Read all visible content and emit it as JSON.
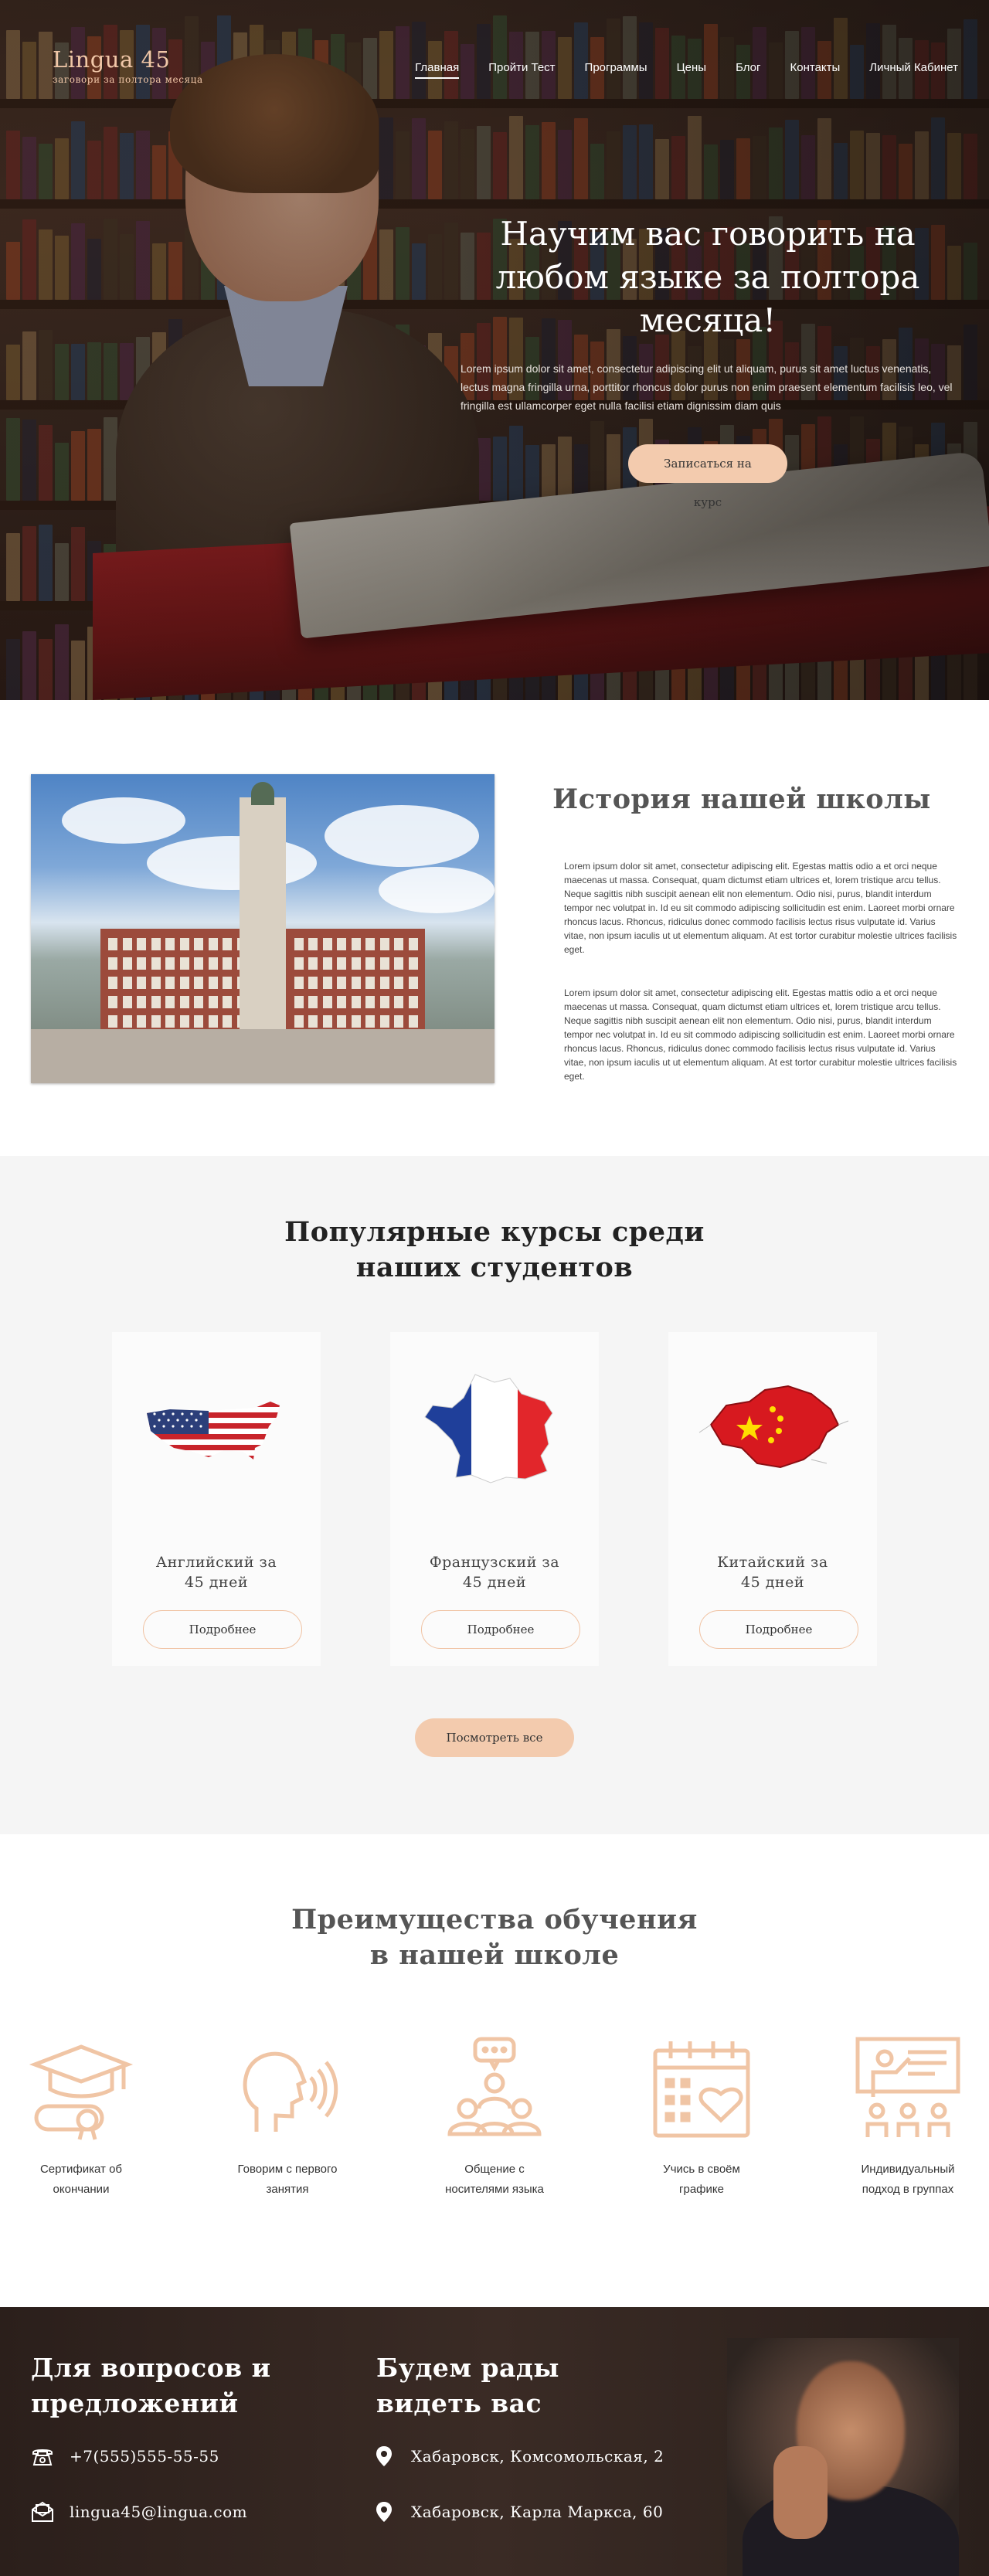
{
  "brand": {
    "name": "Lingua 45",
    "tagline": "заговори за полтора месяца"
  },
  "nav": [
    {
      "label": "Главная",
      "active": true
    },
    {
      "label": "Пройти Тест"
    },
    {
      "label": "Программы"
    },
    {
      "label": "Цены"
    },
    {
      "label": "Блог"
    },
    {
      "label": "Контакты"
    },
    {
      "label": "Личный Кабинет"
    }
  ],
  "hero": {
    "title": "Научим вас говорить на любом языке за полтора месяца!",
    "text": "Lorem ipsum dolor sit amet, consectetur adipiscing elit ut aliquam, purus sit amet luctus venenatis, lectus magna fringilla urna, porttitor rhoncus dolor purus non enim praesent elementum facilisis leo, vel fringilla est ullamcorper eget nulla facilisi etiam dignissim diam quis",
    "button": "Записаться на курс"
  },
  "history": {
    "title": "История нашей школы",
    "paragraphs": [
      "Lorem ipsum dolor sit amet, consectetur adipiscing elit. Egestas mattis odio a et orci neque maecenas ut massa. Consequat, quam dictumst etiam ultrices et, lorem tristique arcu tellus. Neque sagittis nibh suscipit aenean elit non elementum. Odio nisi, purus, blandit interdum tempor nec volutpat in. Id eu sit commodo adipiscing sollicitudin est enim. Laoreet morbi ornare rhoncus lacus. Rhoncus, ridiculus donec commodo facilisis lectus risus vulputate id. Varius vitae, non ipsum iaculis ut ut elementum aliquam. At est tortor curabitur molestie ultrices facilisis eget.",
      "Lorem ipsum dolor sit amet, consectetur adipiscing elit. Egestas mattis odio a et orci neque maecenas ut massa. Consequat, quam dictumst etiam ultrices et, lorem tristique arcu tellus. Neque sagittis nibh suscipit aenean elit non elementum. Odio nisi, purus, blandit interdum tempor nec volutpat in. Id eu sit commodo adipiscing sollicitudin est enim. Laoreet morbi ornare rhoncus lacus. Rhoncus, ridiculus donec commodo facilisis lectus risus vulputate id. Varius vitae, non ipsum iaculis ut ut elementum aliquam. At est tortor curabitur molestie ultrices facilisis eget."
    ]
  },
  "courses": {
    "title_line1": "Популярные курсы среди",
    "title_line2": "наших студентов",
    "items": [
      {
        "name_line1": "Английский за",
        "name_line2": "45 дней",
        "button": "Подробнее",
        "icon": "usa-map-flag-icon"
      },
      {
        "name_line1": "Французский за",
        "name_line2": "45 дней",
        "button": "Подробнее",
        "icon": "france-map-flag-icon"
      },
      {
        "name_line1": "Китайский за",
        "name_line2": "45 дней",
        "button": "Подробнее",
        "icon": "china-map-flag-icon"
      }
    ],
    "see_all": "Посмотреть все"
  },
  "advantages": {
    "title_line1": "Преимущества обучения",
    "title_line2": "в нашей школе",
    "items": [
      {
        "line1": "Сертификат об",
        "line2": "окончании",
        "icon": "graduation-diploma-icon"
      },
      {
        "line1": "Говорим с первого",
        "line2": "занятия",
        "icon": "speaking-head-icon"
      },
      {
        "line1": "Общение с",
        "line2": "носителями языка",
        "icon": "group-chat-icon"
      },
      {
        "line1": "Учись в своём",
        "line2": "графике",
        "icon": "calendar-heart-icon"
      },
      {
        "line1": "Индивидуальный",
        "line2": "подход в группах",
        "icon": "presentation-group-icon"
      }
    ]
  },
  "footer": {
    "contacts_title_line1": "Для вопросов и",
    "contacts_title_line2": "предложений",
    "phone": "+7(555)555-55-55",
    "email": "lingua45@lingua.com",
    "address_title_line1": "Будем рады",
    "address_title_line2": "видеть вас",
    "address1": "Хабаровск, Комсомольская, 2",
    "address2": "Хабаровск, Карла Маркса, 60"
  },
  "colors": {
    "accent": "#f3cbae",
    "accent_icon": "#f0c5a5",
    "footer_bg": "#2f2420",
    "section_bg": "#f5f5f5"
  }
}
